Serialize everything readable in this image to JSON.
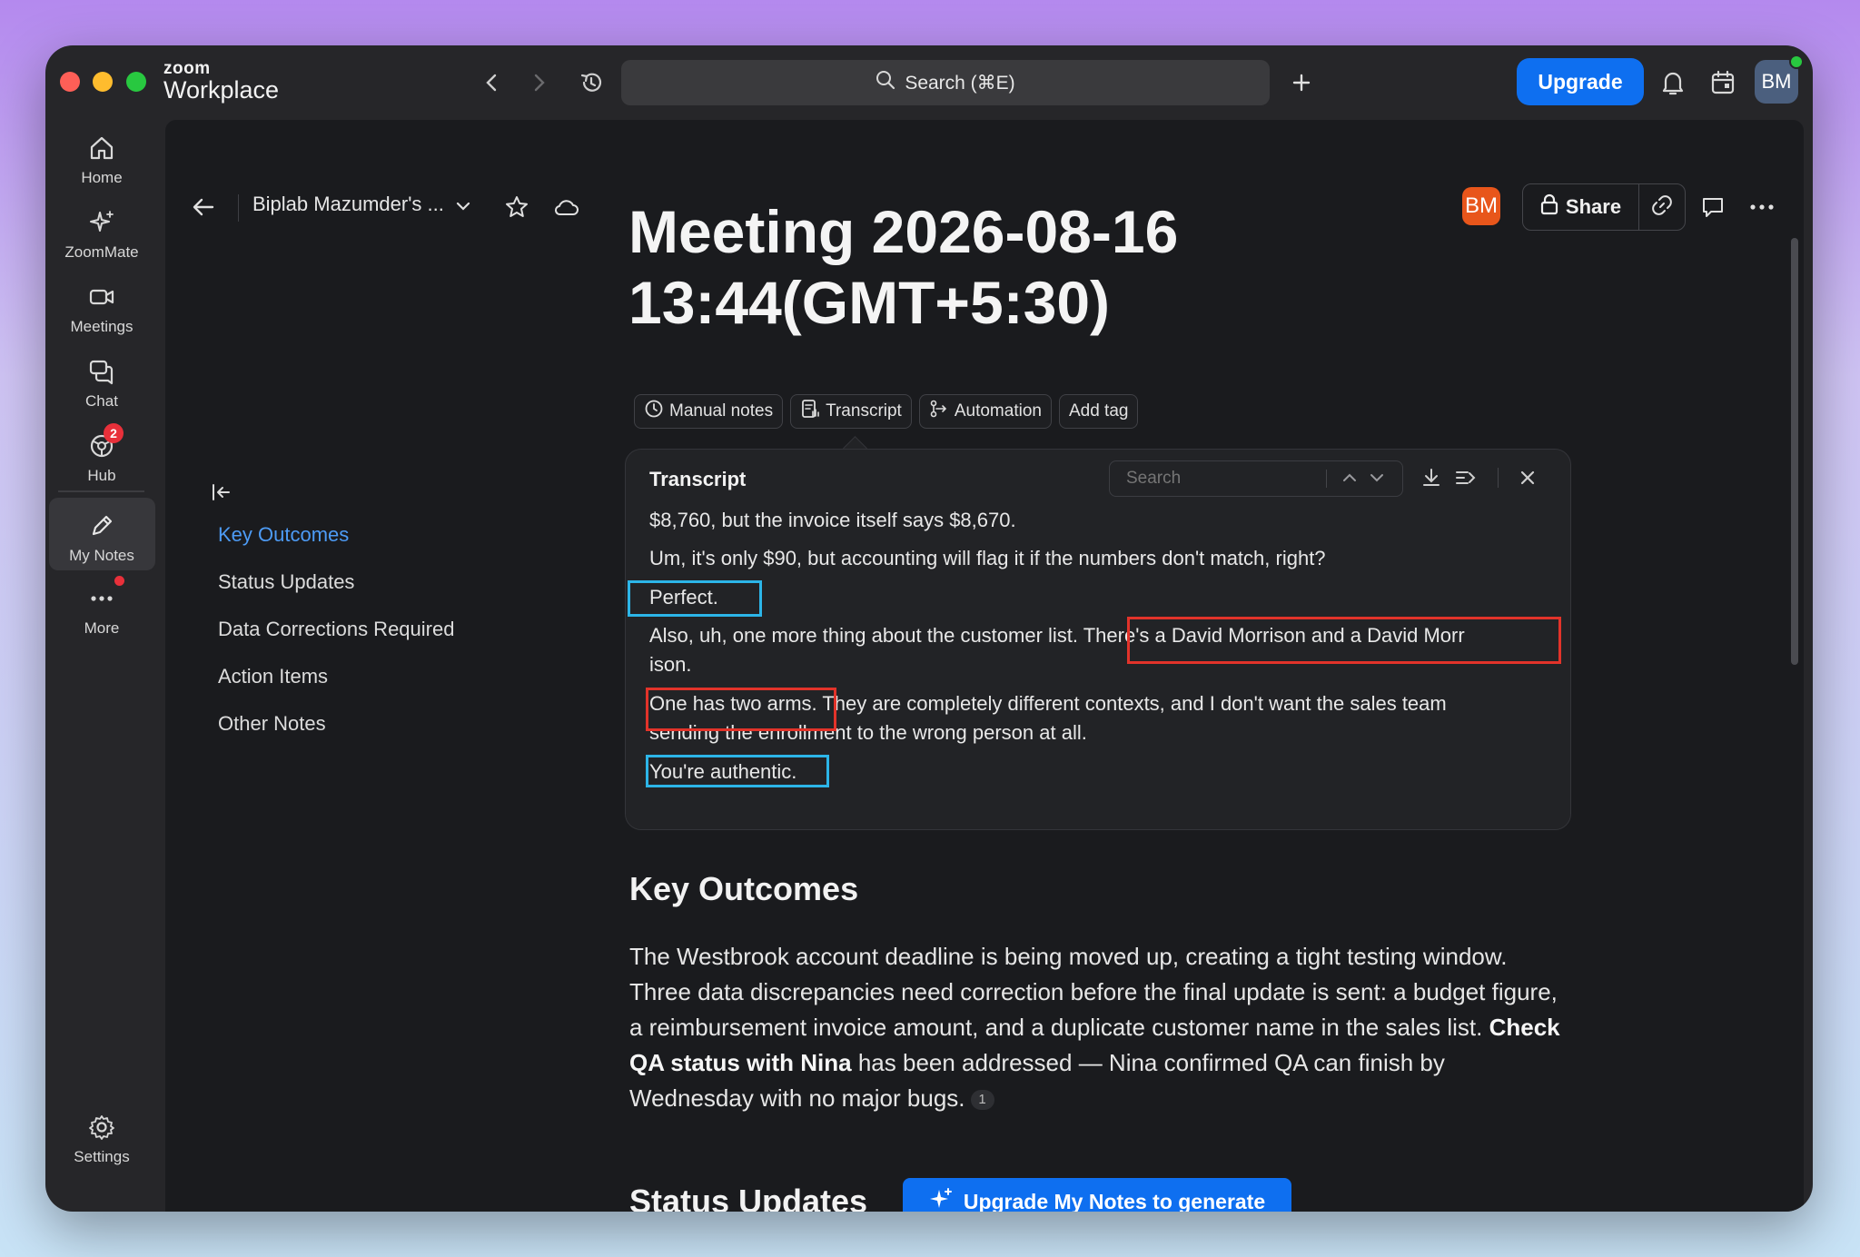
{
  "app": {
    "brand_top": "zoom",
    "brand_bottom": "Workplace",
    "search_label": "Search (⌘E)",
    "upgrade_label": "Upgrade",
    "user_initials": "BM"
  },
  "rail": {
    "items": [
      {
        "label": "Home",
        "icon": "home-icon"
      },
      {
        "label": "ZoomMate",
        "icon": "sparkle-icon"
      },
      {
        "label": "Meetings",
        "icon": "video-icon"
      },
      {
        "label": "Chat",
        "icon": "chat-icon"
      },
      {
        "label": "Hub",
        "icon": "hub-icon",
        "badge": "2"
      },
      {
        "label": "My Notes",
        "icon": "pen-icon",
        "active": true
      },
      {
        "label": "More",
        "icon": "more-icon"
      },
      {
        "label": "Settings",
        "icon": "gear-icon"
      }
    ]
  },
  "header": {
    "breadcrumb": "Biplab Mazumder's ...",
    "owner_initials": "BM",
    "share_label": "Share"
  },
  "toc": {
    "items": [
      "Key Outcomes",
      "Status Updates",
      "Data Corrections Required",
      "Action Items",
      "Other Notes"
    ]
  },
  "note": {
    "title_line1": "Meeting 2026-08-16",
    "title_line2": "13:44(GMT+5:30)",
    "chips": [
      "Manual notes",
      "Transcript",
      "Automation",
      "Add tag"
    ]
  },
  "transcript": {
    "title": "Transcript",
    "search_placeholder": "Search",
    "lines": [
      "$8,760, but the invoice itself says $8,670.",
      "Um, it's only $90, but accounting will flag it if the numbers don't match, right?",
      "Perfect.",
      "Also, uh, one more thing about the customer list. There's a David Morrison and a David Morr",
      "ison.",
      "One has two arms. They are completely different contexts, and I don't want the sales team",
      "sending the enrollment to the wrong person at all.",
      "You're authentic."
    ]
  },
  "sections": {
    "key_outcomes_heading": "Key Outcomes",
    "key_outcomes_text_a": "The Westbrook account deadline is being moved up, creating a tight testing window. Three data discrepancies need correction before the final update is sent: a budget figure, a reimbursement invoice amount, and a duplicate customer name in the sales list. ",
    "key_outcomes_bold": "Check QA status with Nina",
    "key_outcomes_text_b": " has been addressed — Nina confirmed QA can finish by Wednesday with no major bugs.",
    "citation": "1",
    "status_updates_heading": "Status Updates",
    "generate_button": "Upgrade My Notes to generate"
  },
  "colors": {
    "accent": "#0e6ff0",
    "toc_active": "#4d9bf5",
    "highlight_blue": "#2cb5e8",
    "highlight_red": "#e2332a",
    "badge": "#e8303a",
    "owner_avatar": "#e8561b"
  }
}
